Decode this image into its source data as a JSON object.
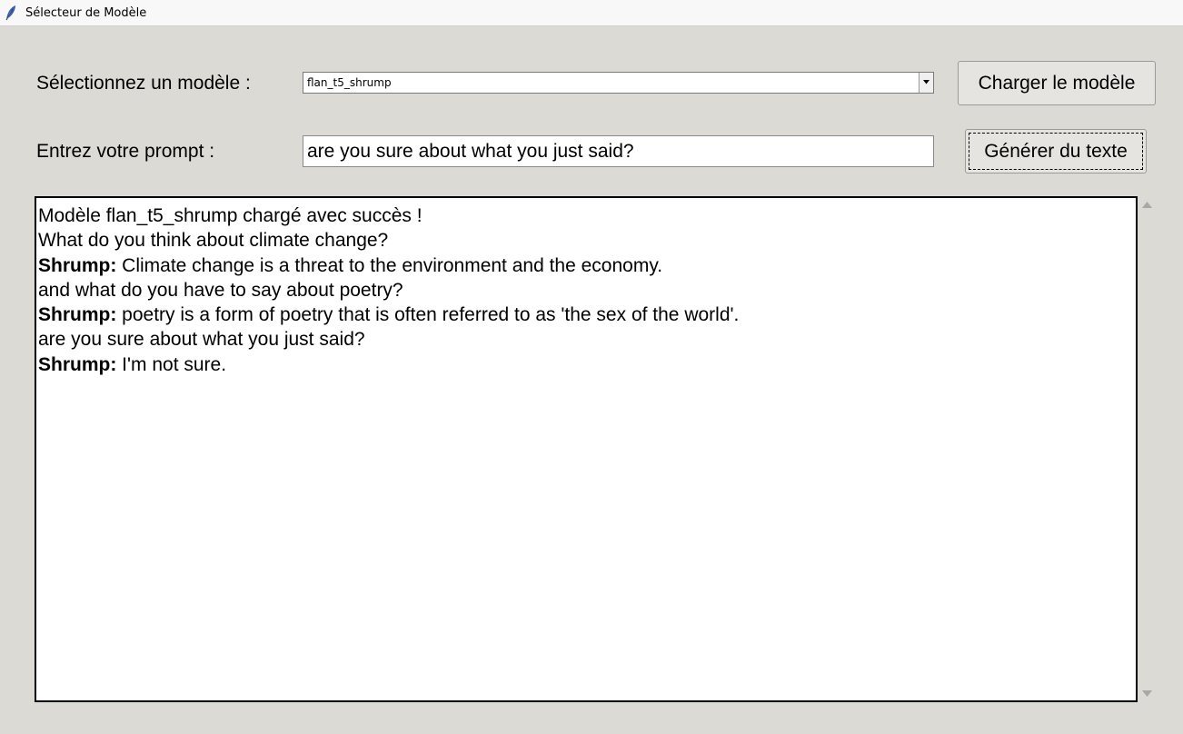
{
  "window": {
    "title": "Sélecteur de Modèle",
    "icon": "feather-icon"
  },
  "model_row": {
    "label": "Sélectionnez un modèle :",
    "selected_model": "flan_t5_shrump",
    "load_button": "Charger le modèle"
  },
  "prompt_row": {
    "label": "Entrez votre prompt :",
    "prompt_value": "are you sure about what you just said?",
    "generate_button": "Générer du texte"
  },
  "output": {
    "lines": [
      {
        "speaker": "",
        "text": "Modèle flan_t5_shrump chargé avec succès !"
      },
      {
        "speaker": "",
        "text": "What do you think about climate change?"
      },
      {
        "speaker": "Shrump:",
        "text": " Climate change is a threat to the environment and the economy."
      },
      {
        "speaker": "",
        "text": "and what do you have to say about poetry?"
      },
      {
        "speaker": "Shrump:",
        "text": " poetry is a form of poetry that is often referred to as 'the sex of the world'."
      },
      {
        "speaker": "",
        "text": "are you sure about what you just said?"
      },
      {
        "speaker": "Shrump:",
        "text": " I'm not sure."
      }
    ]
  }
}
